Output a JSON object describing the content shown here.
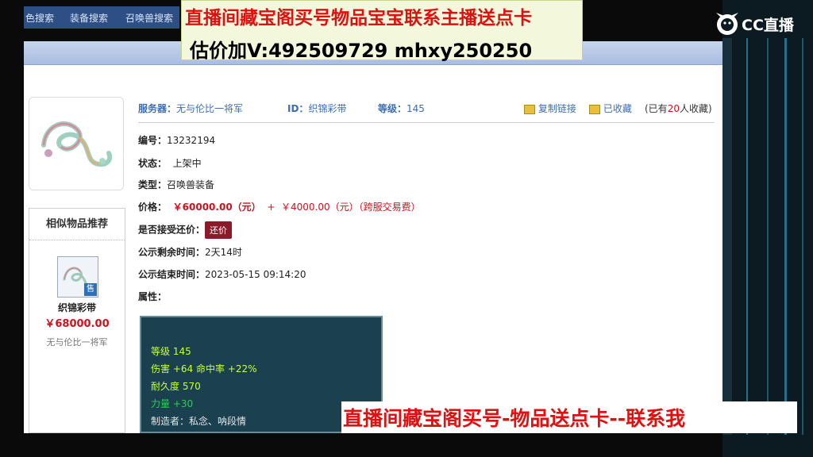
{
  "nav": {
    "items": [
      "色搜索",
      "装备搜索",
      "召唤兽搜索"
    ]
  },
  "overlay": {
    "top_line1": "直播间藏宝阁买号物品宝宝联系主播送点卡",
    "top_line2": "估价加V:492509729    mhxy250250",
    "bottom_line": "直播间藏宝阁买号-物品送点卡--联系我",
    "platform_logo": "CC直播"
  },
  "item": {
    "server_label": "服务器：",
    "server": "无与伦比一将军",
    "id_label": "ID：",
    "id": "织锦彩带",
    "level_label": "等级：",
    "level": "145",
    "copy_link": "复制链接",
    "favorited": "已收藏",
    "fav_prefix": "(已有",
    "fav_count": "20",
    "fav_suffix": "人收藏)",
    "number_label": "编号：",
    "number": "13232194",
    "status_label": "状态：",
    "status": "上架中",
    "type_label": "类型：",
    "type": "召唤兽装备",
    "price_label": "价格：",
    "price": "￥60000.00（元）",
    "price_plus": "+",
    "fee": "￥4000.00（元）（跨服交易费）",
    "counter_label": "是否接受还价：",
    "counter_button": "还价",
    "remaining_label": "公示剩余时间：",
    "remaining": "2天14时",
    "end_label": "公示结束时间：",
    "end_time": "2023-05-15 09:14:20",
    "attr_label": "属性："
  },
  "attributes": {
    "level": "等级 145",
    "damage": "伤害 +64 命中率 +22%",
    "durability": "耐久度 570",
    "strength": "力量 +30",
    "maker": "制造者：私念、呐段情"
  },
  "similar": {
    "title": "相似物品推荐",
    "badge": "售",
    "name": "织锦彩带",
    "price": "￥68000.00",
    "server": "无与伦比一将军"
  },
  "colors": {
    "price_red": "#d0101e",
    "label_blue": "#3d6db0",
    "panel_teal": "#1b4050",
    "attr_yellow": "#c6ff40",
    "attr_green": "#21d34a"
  }
}
